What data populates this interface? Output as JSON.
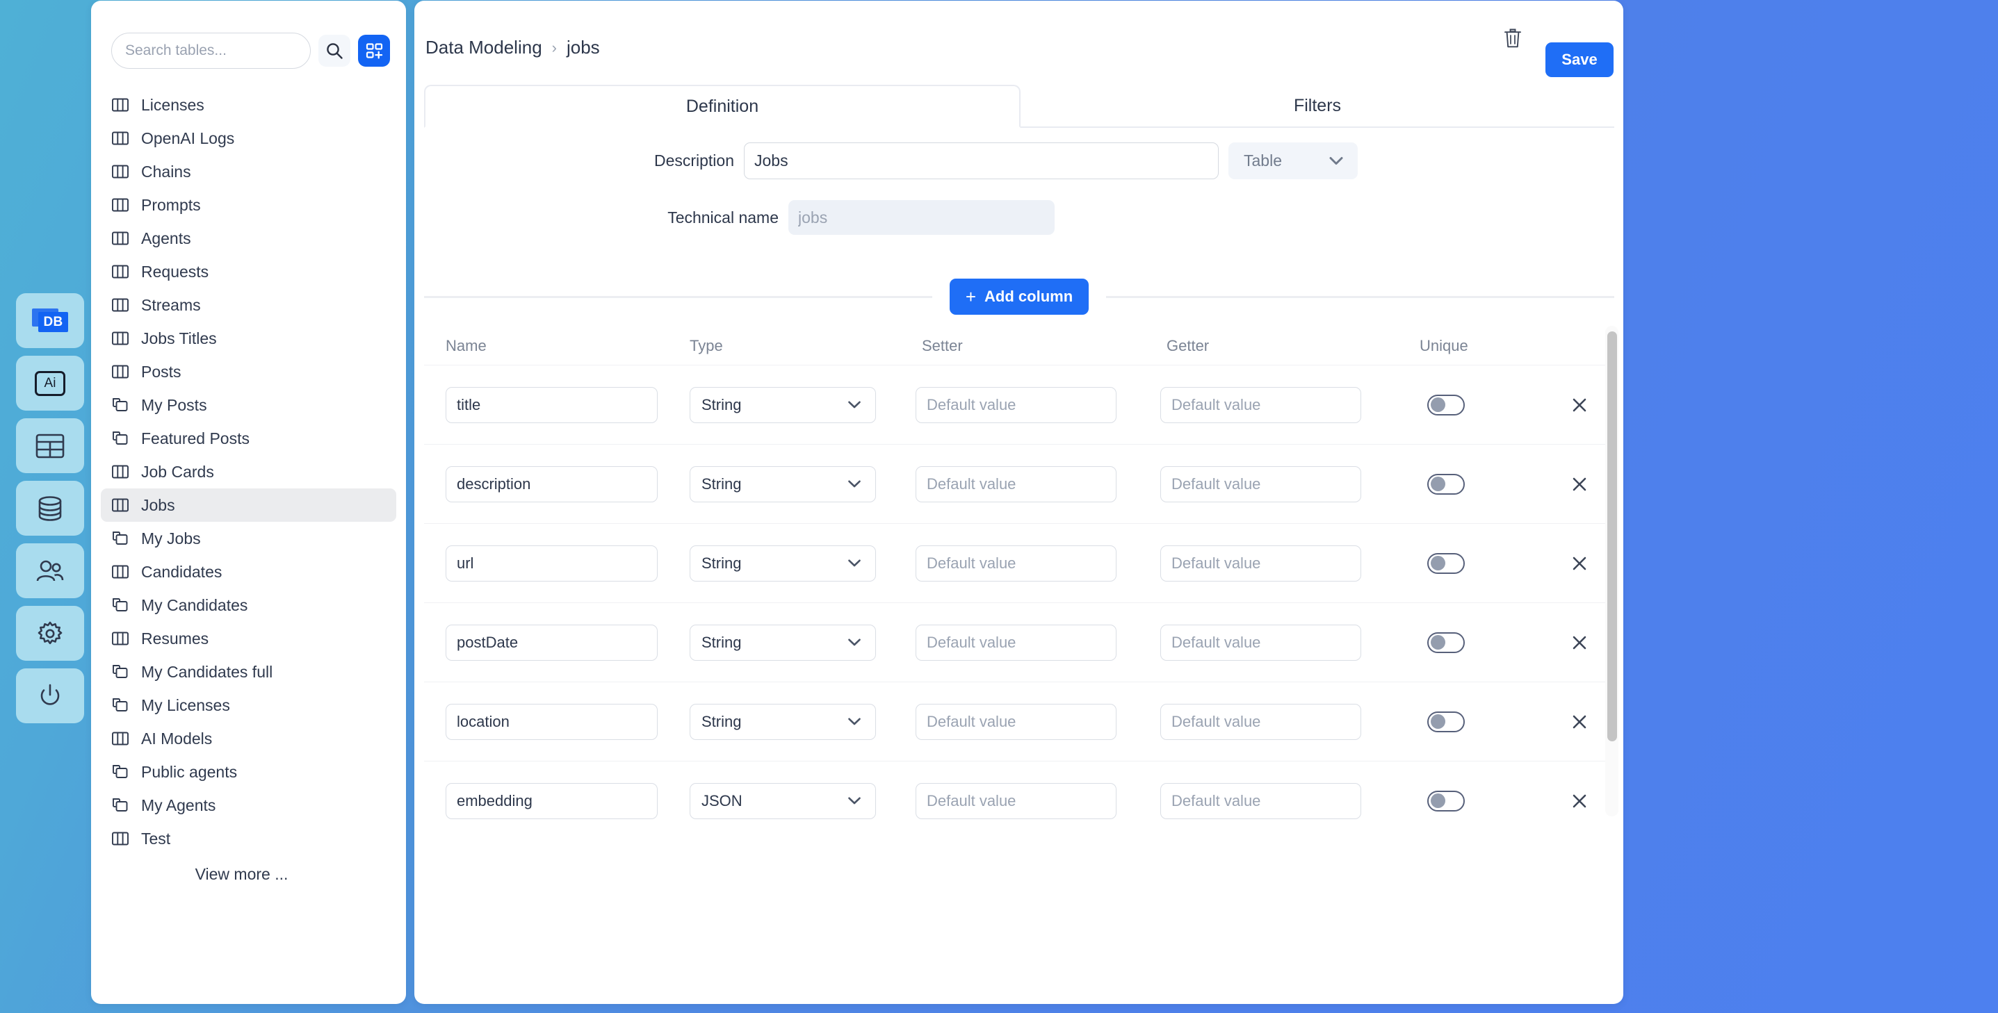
{
  "rail": {
    "items": [
      {
        "name": "db-logo",
        "icon": "db-badge-icon",
        "label": "DB"
      },
      {
        "name": "ai",
        "icon": "ai-box-icon",
        "label": "Ai"
      },
      {
        "name": "tables",
        "icon": "table-grid-icon",
        "label": ""
      },
      {
        "name": "database",
        "icon": "database-cylinder-icon",
        "label": ""
      },
      {
        "name": "users",
        "icon": "people-icon",
        "label": ""
      },
      {
        "name": "settings",
        "icon": "gear-icon",
        "label": ""
      },
      {
        "name": "logout",
        "icon": "power-icon",
        "label": ""
      }
    ]
  },
  "sidebar": {
    "search": {
      "placeholder": "Search tables...",
      "value": ""
    },
    "search_icon": "search-icon",
    "add_icon": "grid-plus-icon",
    "view_more_label": "View more ...",
    "items": [
      {
        "label": "Licenses",
        "icon": "table-columns-icon",
        "active": false
      },
      {
        "label": "OpenAI Logs",
        "icon": "table-columns-icon",
        "active": false
      },
      {
        "label": "Chains",
        "icon": "table-columns-icon",
        "active": false
      },
      {
        "label": "Prompts",
        "icon": "table-columns-icon",
        "active": false
      },
      {
        "label": "Agents",
        "icon": "table-columns-icon",
        "active": false
      },
      {
        "label": "Requests",
        "icon": "table-columns-icon",
        "active": false
      },
      {
        "label": "Streams",
        "icon": "table-columns-icon",
        "active": false
      },
      {
        "label": "Jobs Titles",
        "icon": "table-columns-icon",
        "active": false
      },
      {
        "label": "Posts",
        "icon": "table-columns-icon",
        "active": false
      },
      {
        "label": "My Posts",
        "icon": "view-copy-icon",
        "active": false
      },
      {
        "label": "Featured Posts",
        "icon": "view-copy-icon",
        "active": false
      },
      {
        "label": "Job Cards",
        "icon": "table-columns-icon",
        "active": false
      },
      {
        "label": "Jobs",
        "icon": "table-columns-icon",
        "active": true
      },
      {
        "label": "My Jobs",
        "icon": "view-copy-icon",
        "active": false
      },
      {
        "label": "Candidates",
        "icon": "table-columns-icon",
        "active": false
      },
      {
        "label": "My Candidates",
        "icon": "view-copy-icon",
        "active": false
      },
      {
        "label": "Resumes",
        "icon": "table-columns-icon",
        "active": false
      },
      {
        "label": "My Candidates full",
        "icon": "view-copy-icon",
        "active": false
      },
      {
        "label": "My Licenses",
        "icon": "view-copy-icon",
        "active": false
      },
      {
        "label": "AI Models",
        "icon": "table-columns-icon",
        "active": false
      },
      {
        "label": "Public agents",
        "icon": "view-copy-icon",
        "active": false
      },
      {
        "label": "My Agents",
        "icon": "view-copy-icon",
        "active": false
      },
      {
        "label": "Test",
        "icon": "table-columns-icon",
        "active": false
      }
    ]
  },
  "main": {
    "breadcrumb": {
      "root": "Data Modeling",
      "separator": "›",
      "current": "jobs"
    },
    "trash_icon": "trash-icon",
    "save_label": "Save",
    "tabs": [
      {
        "label": "Definition",
        "active": true
      },
      {
        "label": "Filters",
        "active": false
      }
    ],
    "form": {
      "description_label": "Description",
      "description_value": "Jobs",
      "entity_type_value": "Table",
      "entity_type_caret": "chevron-down-icon",
      "technical_name_label": "Technical name",
      "technical_name_value": "",
      "technical_name_placeholder": "jobs"
    },
    "add_column_label": "Add column",
    "add_column_plus": "+",
    "columns_table": {
      "headers": [
        "Name",
        "Type",
        "Setter",
        "Getter",
        "Unique"
      ],
      "setter_placeholder": "Default value",
      "getter_placeholder": "Default value",
      "delete_icon": "close-icon",
      "rows": [
        {
          "name": "title",
          "type": "String",
          "setter": "",
          "getter": "",
          "unique": false
        },
        {
          "name": "description",
          "type": "String",
          "setter": "",
          "getter": "",
          "unique": false
        },
        {
          "name": "url",
          "type": "String",
          "setter": "",
          "getter": "",
          "unique": false
        },
        {
          "name": "postDate",
          "type": "String",
          "setter": "",
          "getter": "",
          "unique": false
        },
        {
          "name": "location",
          "type": "String",
          "setter": "",
          "getter": "",
          "unique": false
        },
        {
          "name": "embedding",
          "type": "JSON",
          "setter": "",
          "getter": "",
          "unique": false
        }
      ]
    }
  },
  "colors": {
    "accent": "#1f6ef6",
    "accent_alt": "#1364f3",
    "rail_tile": "#a9dcee",
    "text": "#2d374b",
    "muted": "#7b8494",
    "active_row": "#ebecee"
  }
}
